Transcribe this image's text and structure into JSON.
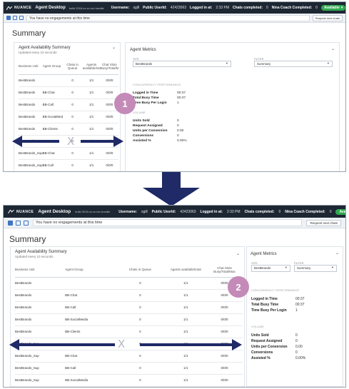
{
  "colors": {
    "topbar": "#1d2733",
    "accent": "#3f74c4",
    "available": "#2fa84f",
    "badge": "#c48ab8",
    "arrow": "#1f2a66"
  },
  "topbar": {
    "logo": "NUANCE",
    "app": "Agent Desktop",
    "version": "build 2018.xx.xx.xxx bundle",
    "username_label": "Username:",
    "username": "sgill",
    "userid_label": "Public UserId:",
    "userid": "42423063",
    "loggedin_label": "Logged in at:",
    "loggedin": "2:33 PM",
    "chats_label": "Chats completed:",
    "chats": "0",
    "nina_label": "Nina Coach Completed:",
    "nina": "0",
    "status": "Available",
    "status_icon": "chevron-down-icon",
    "settings_icon": "gear-icon"
  },
  "subbar": {
    "message": "You have no engagements at this time",
    "button": "Request next chats",
    "button2": "Request next chats"
  },
  "summary_title": "Summary",
  "top": {
    "availability": {
      "title": "Agent Availability Summary",
      "subtitle": "Updated every 10 seconds",
      "headers": [
        "Business Unit",
        "Agent Group",
        "Chats in Queue",
        "Agents available/total",
        "Chat Slots Busy/Total/Max"
      ],
      "rows": [
        [
          "BestBrands",
          "",
          "0",
          "1/1",
          "0/0/0"
        ],
        [
          "BestBrands",
          "BB-Chat",
          "0",
          "1/1",
          "0/0/0"
        ],
        [
          "BestBrands",
          "BB-Call",
          "0",
          "1/1",
          "0/0/0"
        ],
        [
          "BestBrands",
          "BB-SocialMedia",
          "0",
          "1/1",
          "0/0/0"
        ],
        [
          "BestBrands",
          "BB-Clients",
          "0",
          "1/1",
          "0/0/0"
        ],
        [
          "BestBrands_Sup",
          "",
          "0",
          "1/1",
          "0/0/0"
        ],
        [
          "BestBrands_Sup",
          "BB-Chat",
          "0",
          "1/1",
          "0/0/0"
        ],
        [
          "BestBrands_Sup",
          "BB-Call",
          "0",
          "1/1",
          "0/0/0"
        ]
      ]
    },
    "metrics": {
      "title": "Agent Metrics",
      "site_label": "SITE",
      "filter_label": "FILTER",
      "site": "BestBrands",
      "filter": "Summary",
      "section1": "CONCURRENCY PERFORMANCE",
      "m1": [
        [
          "Logged in Time",
          "00:37"
        ],
        [
          "Total Busy Time",
          "00:37"
        ],
        [
          "Time Busy Per Login",
          "1"
        ]
      ],
      "section2": "VOLUME",
      "m2": [
        [
          "Units Sold",
          "0"
        ],
        [
          "Request Assigned",
          "0"
        ],
        [
          "Units per Conversion",
          "0.00"
        ],
        [
          "Conversions",
          "0"
        ],
        [
          "Assisted %",
          "0.00%"
        ]
      ]
    },
    "badge": "1",
    "x": "X"
  },
  "bottom": {
    "availability": {
      "title": "Agent Availability Summary",
      "subtitle": "Updated every 10 seconds",
      "headers": [
        "Business Unit",
        "Agent Group",
        "Chats in Queue",
        "Agents available/total",
        "Chat Slots Busy/Total/Max"
      ],
      "rows": [
        [
          "BestBrands",
          "",
          "0",
          "1/1",
          "0/0/0"
        ],
        [
          "BestBrands",
          "BB-Chat",
          "0",
          "1/1",
          "0/0/0"
        ],
        [
          "BestBrands",
          "BB-Call",
          "0",
          "1/1",
          "0/0/0"
        ],
        [
          "BestBrands",
          "BB-SocialMedia",
          "0",
          "1/1",
          "0/0/0"
        ],
        [
          "BestBrands",
          "BB-Clients",
          "0",
          "1/1",
          "0/0/0"
        ],
        [
          "BestBrands_Sup",
          "",
          "0",
          "1/1",
          "0/0/0"
        ],
        [
          "BestBrands_Sup",
          "BB-Chat",
          "0",
          "1/1",
          "0/0/0"
        ],
        [
          "BestBrands_Sup",
          "BB-Call",
          "0",
          "1/1",
          "0/0/0"
        ],
        [
          "BestBrands_Sup",
          "BB-SocialMedia",
          "0",
          "1/1",
          "0/0/0"
        ]
      ]
    },
    "metrics": {
      "title": "Agent Metrics",
      "site_label": "SITE",
      "filter_label": "FILTER",
      "site": "BestBrands",
      "filter": "Summary",
      "section1": "CONCURRENCY PERFORMANCE",
      "m1": [
        [
          "Logged in Time",
          "00:37"
        ],
        [
          "Total Busy Time",
          "00:37"
        ],
        [
          "Time Busy Per Login",
          "1"
        ]
      ],
      "section2": "VOLUME",
      "m2": [
        [
          "Units Sold",
          "0"
        ],
        [
          "Request Assigned",
          "0"
        ],
        [
          "Units per Conversion",
          "0.00"
        ],
        [
          "Conversions",
          "0"
        ],
        [
          "Assisted %",
          "0.00%"
        ]
      ]
    },
    "badge": "2",
    "x": "X"
  }
}
